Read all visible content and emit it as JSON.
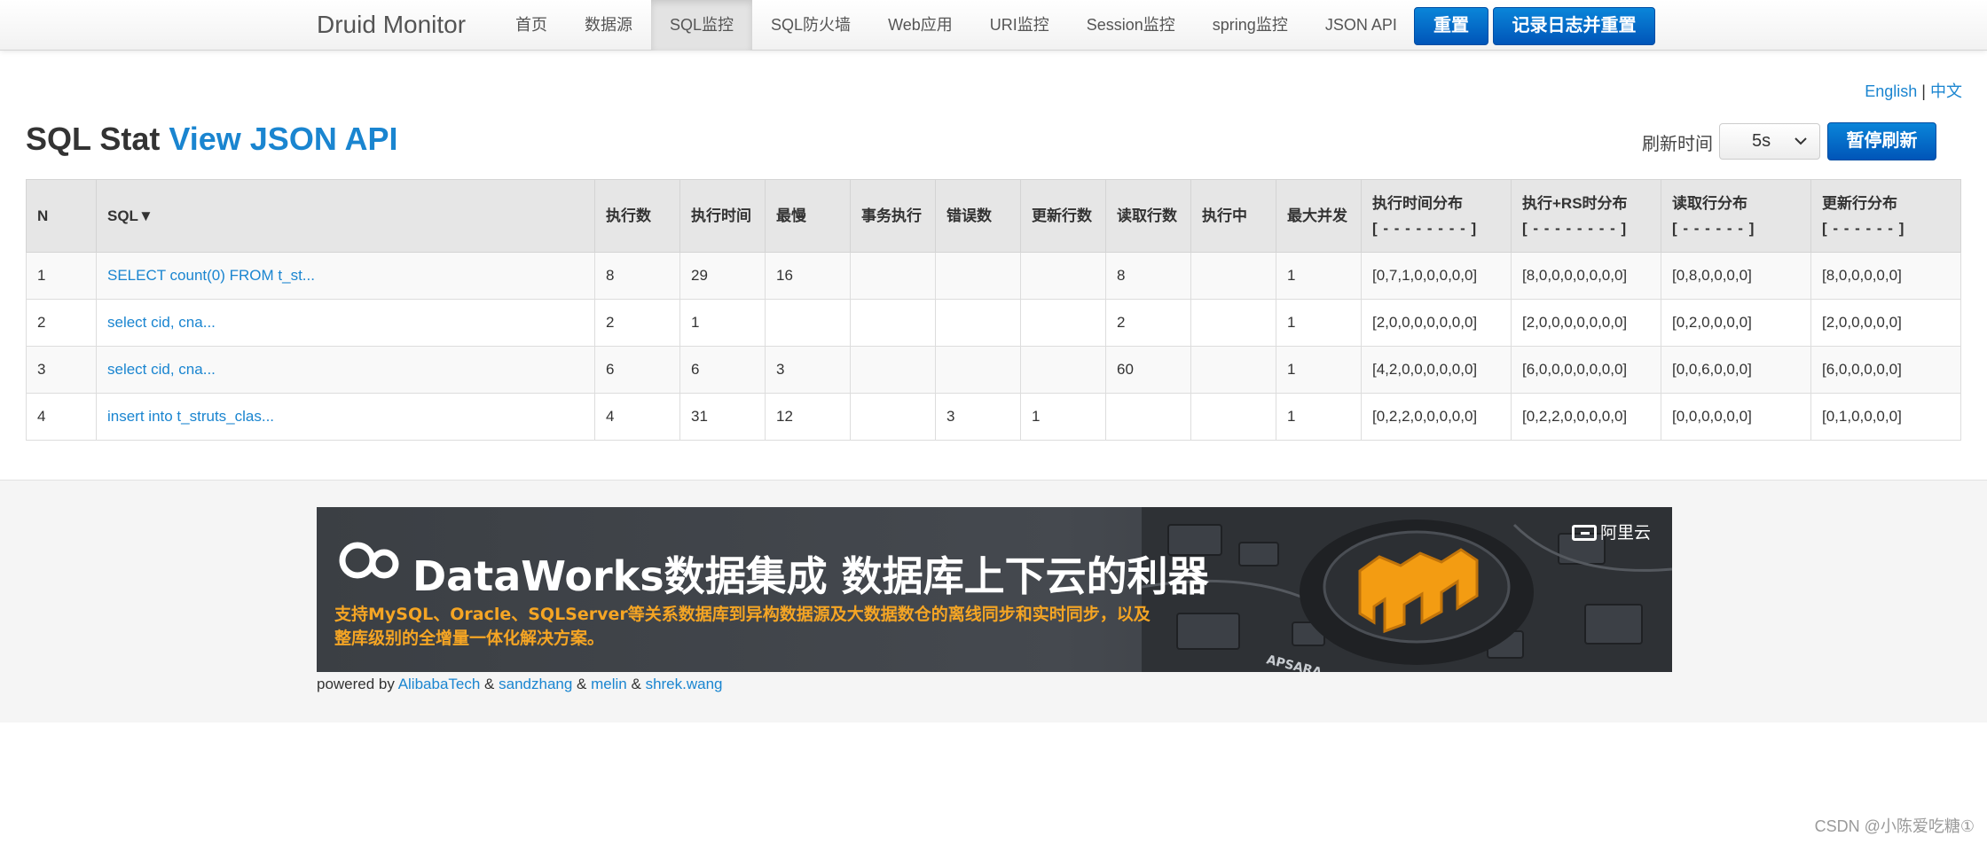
{
  "nav": {
    "brand": "Druid Monitor",
    "items": [
      {
        "label": "首页"
      },
      {
        "label": "数据源"
      },
      {
        "label": "SQL监控"
      },
      {
        "label": "SQL防火墙"
      },
      {
        "label": "Web应用"
      },
      {
        "label": "URI监控"
      },
      {
        "label": "Session监控"
      },
      {
        "label": "spring监控"
      },
      {
        "label": "JSON API"
      }
    ],
    "active_index": 2,
    "reset_label": "重置",
    "log_reset_label": "记录日志并重置"
  },
  "lang": {
    "english": "English",
    "separator": "|",
    "chinese": "中文"
  },
  "page": {
    "title_prefix": "SQL Stat",
    "title_link": "View JSON API",
    "refresh_label": "刷新时间",
    "refresh_value": "5s",
    "pause_label": "暂停刷新"
  },
  "table": {
    "headers": {
      "n": "N",
      "sql": "SQL▼",
      "exec_count": "执行数",
      "exec_time": "执行时间",
      "slowest": "最慢",
      "txn": "事务执行",
      "errors": "错误数",
      "update_rows": "更新行数",
      "read_rows": "读取行数",
      "running": "执行中",
      "max_concurrent": "最大并发",
      "exec_hist": "执行时间分布",
      "exec_hist_sub": "[ - - - - - - - - ]",
      "exec_rs_hist": "执行+RS时分布",
      "exec_rs_hist_sub": "[ - - - - - - - - ]",
      "read_hist": "读取行分布",
      "read_hist_sub": "[ - - - - - - ]",
      "update_hist": "更新行分布",
      "update_hist_sub": "[ - - - - - - ]"
    },
    "rows": [
      {
        "n": "1",
        "sql": "SELECT count(0) FROM t_st...",
        "exec_count": "8",
        "exec_time": "29",
        "slowest": "16",
        "txn": "",
        "errors": "",
        "update_rows": "",
        "read_rows": "8",
        "running": "",
        "max_concurrent": "1",
        "exec_hist": "[0,7,1,0,0,0,0,0]",
        "exec_rs_hist": "[8,0,0,0,0,0,0,0]",
        "read_hist": "[0,8,0,0,0,0]",
        "update_hist": "[8,0,0,0,0,0]"
      },
      {
        "n": "2",
        "sql": "select cid, cna...",
        "exec_count": "2",
        "exec_time": "1",
        "slowest": "",
        "txn": "",
        "errors": "",
        "update_rows": "",
        "read_rows": "2",
        "running": "",
        "max_concurrent": "1",
        "exec_hist": "[2,0,0,0,0,0,0,0]",
        "exec_rs_hist": "[2,0,0,0,0,0,0,0]",
        "read_hist": "[0,2,0,0,0,0]",
        "update_hist": "[2,0,0,0,0,0]"
      },
      {
        "n": "3",
        "sql": "select cid, cna...",
        "exec_count": "6",
        "exec_time": "6",
        "slowest": "3",
        "txn": "",
        "errors": "",
        "update_rows": "",
        "read_rows": "60",
        "running": "",
        "max_concurrent": "1",
        "exec_hist": "[4,2,0,0,0,0,0,0]",
        "exec_rs_hist": "[6,0,0,0,0,0,0,0]",
        "read_hist": "[0,0,6,0,0,0]",
        "update_hist": "[6,0,0,0,0,0]"
      },
      {
        "n": "4",
        "sql": "insert into t_struts_clas...",
        "exec_count": "4",
        "exec_time": "31",
        "slowest": "12",
        "txn": "",
        "errors": "3",
        "update_rows": "1",
        "read_rows": "",
        "running": "",
        "max_concurrent": "1",
        "exec_hist": "[0,2,2,0,0,0,0,0]",
        "exec_rs_hist": "[0,2,2,0,0,0,0,0]",
        "read_hist": "[0,0,0,0,0,0]",
        "update_hist": "[0,1,0,0,0,0]"
      }
    ]
  },
  "banner": {
    "title": "DataWorks数据集成 数据库上下云的利器",
    "description": "支持MySQL、Oracle、SQLServer等关系数据库到异构数据源及大数据数仓的离线同步和实时同步，以及整库级别的全增量一体化解决方案。",
    "brand": "阿里云",
    "art_text": "APSARA"
  },
  "footer": {
    "powered_by": "powered by",
    "amp": "&",
    "credits": [
      "AlibabaTech",
      "sandzhang",
      "melin",
      "shrek.wang"
    ]
  },
  "watermark": "CSDN @小陈爱吃糖①",
  "colors": {
    "link": "#1a85d0",
    "button": "#0a6fcf",
    "banner_accent": "#f5a524"
  }
}
